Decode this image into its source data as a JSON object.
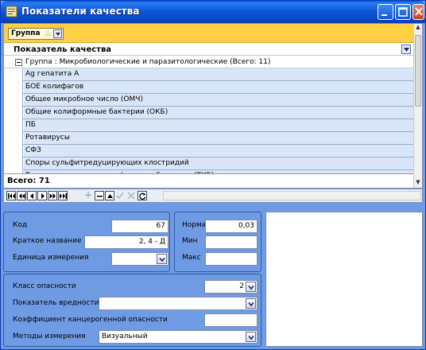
{
  "window": {
    "title": "Показатели качества"
  },
  "grid": {
    "group_button_label": "Группа",
    "column_header": "Показатель качества",
    "group_row": "Группа : Микробиологические и паразитологические (Всего: 11)",
    "rows": [
      "Ag гепатита А",
      "БОЕ колифагов",
      "Общее микробное число (ОМЧ)",
      "Общие колиформные бактерии (ОКБ)",
      "ПБ",
      "Ротавирусы",
      "СФЗ",
      "Споры сульфитредуцирующих клостридий",
      "Термотолерантные колиформные бактерии (ТКБ)"
    ],
    "footer": "Всего: 71"
  },
  "form": {
    "code_label": "Код",
    "code_value": "67",
    "short_name_label": "Краткое название",
    "short_name_value": "2, 4 - Д",
    "unit_label": "Единица измерения",
    "unit_value": "",
    "norm_label": "Норма",
    "norm_value": "0,03",
    "min_label": "Мин",
    "min_value": "",
    "max_label": "Макс",
    "max_value": "",
    "hazard_label": "Класс опасности",
    "hazard_value": "2",
    "harm_label": "Показатель вредности",
    "harm_value": "",
    "carc_label": "Коэффициент канцерогенной опасности",
    "carc_value": "",
    "method_label": "Методы измерения",
    "method_value": "Визуальный"
  },
  "colors": {
    "titlebar": "#0a5fe8",
    "groupbar": "#ffd042",
    "panel": "#6e9be3",
    "row": "#d9e6f7"
  }
}
